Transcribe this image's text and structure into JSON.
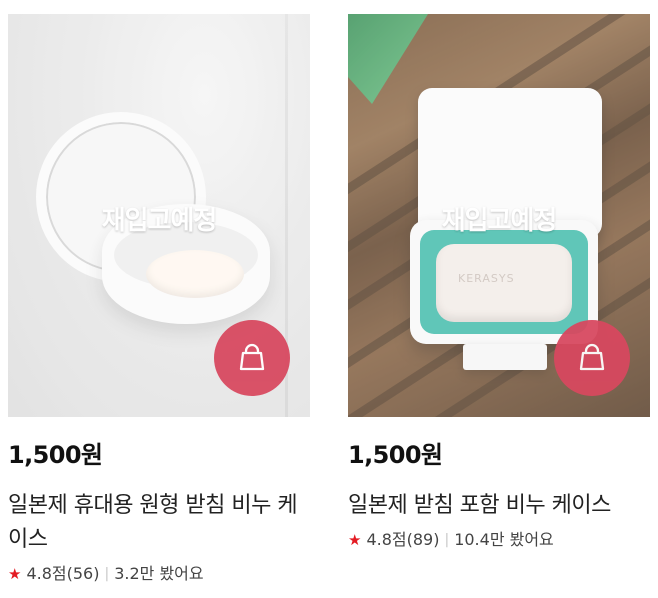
{
  "products": [
    {
      "overlay_text": "재입고예정",
      "price": "1,500원",
      "name": "일본제 휴대용 원형 받침 비누 케이스",
      "rating_text": "4.8점(56)",
      "views_text": "3.2만 봤어요",
      "cart_icon": "shopping-bag-icon",
      "star_icon": "star-icon"
    },
    {
      "overlay_text": "재입고예정",
      "price": "1,500원",
      "name": "일본제 받침 포함 비누 케이스",
      "rating_text": "4.8점(89)",
      "views_text": "10.4만 봤어요",
      "cart_icon": "shopping-bag-icon",
      "star_icon": "star-icon",
      "image_brand_text": "KERASYS"
    }
  ],
  "colors": {
    "cart_button": "#d8485f",
    "star": "#e31b23",
    "mint_case": "#39b8a7"
  }
}
